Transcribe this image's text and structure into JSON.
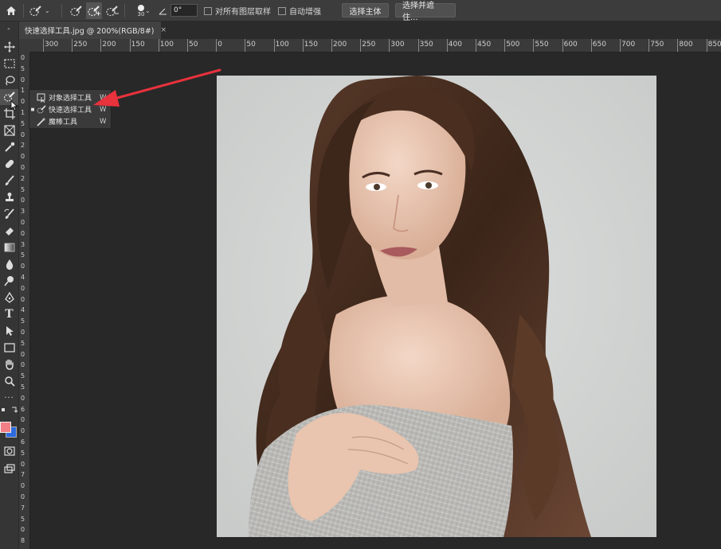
{
  "options_bar": {
    "brush_size": "30",
    "angle_value": "0°",
    "sample_all_layers_label": "对所有图层取样",
    "auto_enhance_label": "自动增强",
    "select_subject_label": "选择主体",
    "select_and_mask_label": "选择并遮住..."
  },
  "document_tab": {
    "title": "快速选择工具.jpg @ 200%(RGB/8#)",
    "close": "×"
  },
  "ruler": {
    "horizontal_labels": [
      "300",
      "250",
      "200",
      "150",
      "100",
      "50",
      "0",
      "50",
      "100",
      "150",
      "200",
      "250",
      "300",
      "350",
      "400",
      "450",
      "500",
      "550",
      "600",
      "650",
      "700",
      "750",
      "800",
      "850"
    ],
    "vertical_labels": [
      "0",
      "5",
      "0",
      "1",
      "0",
      "1",
      "5",
      "0",
      "2",
      "0",
      "0",
      "2",
      "5",
      "0",
      "3",
      "0",
      "0",
      "3",
      "5",
      "0",
      "4",
      "0",
      "0",
      "4",
      "5",
      "0",
      "5",
      "0",
      "0",
      "5",
      "5",
      "0",
      "6",
      "0",
      "0",
      "6",
      "5",
      "0",
      "7",
      "0",
      "0",
      "7",
      "5",
      "0",
      "8"
    ]
  },
  "tool_flyout": {
    "items": [
      {
        "label": "对象选择工具",
        "shortcut": "W",
        "selected": false,
        "icon": "object-selection-icon"
      },
      {
        "label": "快速选择工具",
        "shortcut": "W",
        "selected": true,
        "icon": "quick-selection-icon"
      },
      {
        "label": "魔棒工具",
        "shortcut": "W",
        "selected": false,
        "icon": "magic-wand-icon"
      }
    ],
    "selected_bullet": "■"
  },
  "colors": {
    "foreground": "#f27f86",
    "background": "#2f6be0",
    "annotation_arrow": "#e8323c"
  }
}
